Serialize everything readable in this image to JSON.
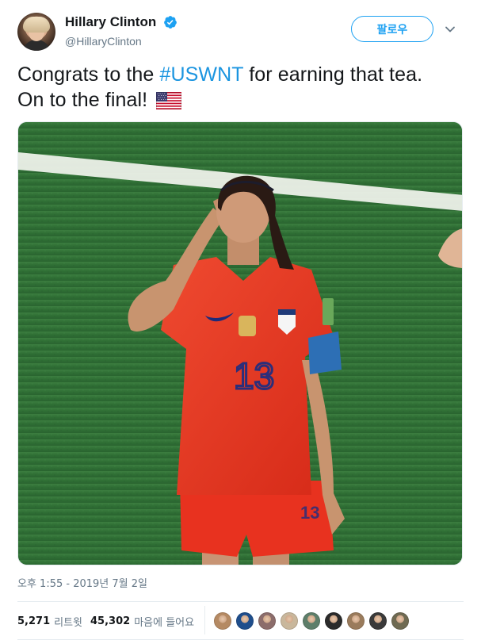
{
  "tweet": {
    "author": {
      "display_name": "Hillary Clinton",
      "handle": "@HillaryClinton",
      "verified": true
    },
    "follow_button_label": "팔로우",
    "text": {
      "before_hashtag": "Congrats to the ",
      "hashtag": "#USWNT",
      "after_hashtag": " for earning that tea.",
      "second_line": "On to the final!"
    },
    "timestamp": "오후 1:55 - 2019년 7월 2일",
    "stats": {
      "retweets_count": "5,271",
      "retweets_label": "리트윗",
      "likes_count": "45,302",
      "likes_label": "마음에 들어요"
    }
  },
  "colors": {
    "accent": "#1da1f2",
    "hashtag": "#1b95e0",
    "text_primary": "#14171a",
    "text_secondary": "#657786",
    "jersey": "#e8321f",
    "pitch": "#2f6f35"
  },
  "icons": {
    "verified": "verified-badge-icon",
    "more": "chevron-down-icon",
    "emoji": "us-flag-icon"
  },
  "likers": [
    {
      "name": "liker-avatar-1",
      "color": "#b58a63"
    },
    {
      "name": "liker-avatar-2",
      "color": "#1f4e8c"
    },
    {
      "name": "liker-avatar-3",
      "color": "#8c6d6b"
    },
    {
      "name": "liker-avatar-4",
      "color": "#c9b79c"
    },
    {
      "name": "liker-avatar-5",
      "color": "#5e7e6a"
    },
    {
      "name": "liker-avatar-6",
      "color": "#2b2b2b"
    },
    {
      "name": "liker-avatar-7",
      "color": "#9a7b5c"
    },
    {
      "name": "liker-avatar-8",
      "color": "#3a3a3a"
    },
    {
      "name": "liker-avatar-9",
      "color": "#6f6a52"
    }
  ]
}
